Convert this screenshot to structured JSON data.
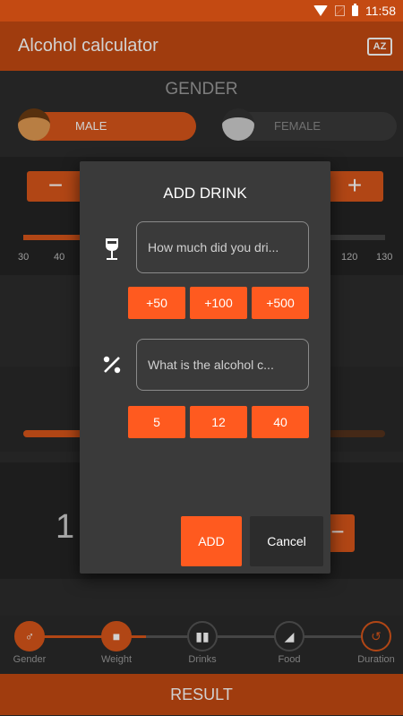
{
  "status_bar": {
    "time": "11:58"
  },
  "app": {
    "title": "Alcohol calculator",
    "sort_icon_label": "AZ"
  },
  "gender": {
    "title": "GENDER",
    "male_label": "MALE",
    "female_label": "FEMALE"
  },
  "weight": {
    "minus_label": "−",
    "plus_label": "+",
    "ticks": [
      "30",
      "40",
      "120",
      "130"
    ]
  },
  "background_result": {
    "value": "1"
  },
  "stepper": {
    "steps": [
      {
        "label": "Gender",
        "icon": "male-symbol-icon"
      },
      {
        "label": "Weight",
        "icon": "scale-icon"
      },
      {
        "label": "Drinks",
        "icon": "bottles-icon"
      },
      {
        "label": "Food",
        "icon": "food-icon"
      },
      {
        "label": "Duration",
        "icon": "history-icon"
      }
    ]
  },
  "result_bar": {
    "label": "RESULT"
  },
  "dialog": {
    "title": "ADD DRINK",
    "amount_placeholder": "How much did you dri...",
    "amount_buttons": [
      "+50",
      "+100",
      "+500"
    ],
    "percent_placeholder": "What is the alcohol c...",
    "percent_buttons": [
      "5",
      "12",
      "40"
    ],
    "add_label": "ADD",
    "cancel_label": "Cancel"
  },
  "colors": {
    "primary": "#c44a12",
    "accent": "#ff5a1f",
    "dialog_bg": "#3a3a3a",
    "screen_bg": "#2c2c2c"
  }
}
